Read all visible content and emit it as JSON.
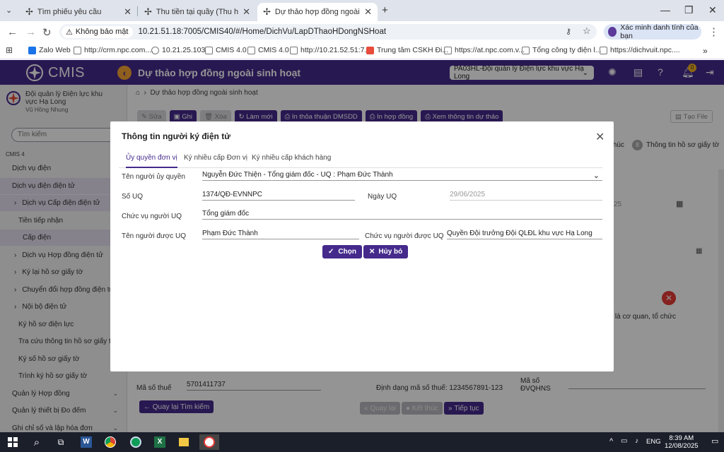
{
  "browser": {
    "tabs": [
      {
        "title": "Tìm phiếu yêu cầu",
        "active": false
      },
      {
        "title": "Thu tiền tại quầy (Thu hộ, ứng t",
        "active": false
      },
      {
        "title": "Dự thảo hợp đồng ngoài sinh h",
        "active": true
      }
    ],
    "new_tab": "+",
    "insecure_label": "Không bảo mật",
    "url": "10.21.51.18:7005/CMIS40/#/Home/DichVu/LapDThaoHDongNSHoat",
    "incognito_label": "Xác minh danh tính của bạn",
    "bookmarks": [
      "Zalo Web",
      "http://crm.npc.com....",
      "10.21.25.103",
      "CMIS 4.0",
      "CMIS 4.0",
      "http://10.21.52.51:7...",
      "Trung tâm CSKH Đi...",
      "https://at.npc.com.v...",
      "Tổng công ty điện l...",
      "https://dichvuit.npc...."
    ]
  },
  "app": {
    "logo": "CMIS",
    "page_title": "Dự thảo hợp đồng ngoài sinh hoạt",
    "unit_select": "PA03HL-Đội quản lý Điện lực khu vực Hạ Long",
    "notification_count": "0"
  },
  "sidebar": {
    "org_name": "Đội quản lý Điện lực khu vực Hạ Long",
    "user": "Vũ Hồng Nhung",
    "search_placeholder": "Tìm kiếm",
    "section": "CMIS 4",
    "items": [
      {
        "label": "Dịch vụ điện",
        "indent": 0,
        "chev": false,
        "hl": false
      },
      {
        "label": "Dịch vụ điện điện tử",
        "indent": 0,
        "chev": false,
        "hl": true
      },
      {
        "label": "Dịch vụ Cấp điện điện tử",
        "indent": 1,
        "chev": true,
        "hl": true
      },
      {
        "label": "Tiền tiếp nhận",
        "indent": 2,
        "chev": false,
        "hl": false
      },
      {
        "label": "Cấp điện",
        "indent": 2,
        "chev": false,
        "hl": true
      },
      {
        "label": "Dịch vụ Hợp đồng điện tử",
        "indent": 1,
        "chev": true,
        "hl": false
      },
      {
        "label": "Ký lại hồ sơ giấy tờ",
        "indent": 1,
        "chev": true,
        "hl": false
      },
      {
        "label": "Chuyển đổi hợp đồng điện tử",
        "indent": 1,
        "chev": true,
        "hl": false
      },
      {
        "label": "Nội bộ điện tử",
        "indent": 1,
        "chev": true,
        "hl": false
      },
      {
        "label": "Ký hồ sơ điện lực",
        "indent": 2,
        "chev": false,
        "hl": false
      },
      {
        "label": "Tra cứu thông tin hồ sơ giấy tờ",
        "indent": 2,
        "chev": false,
        "hl": false
      },
      {
        "label": "Ký số hồ sơ giấy tờ",
        "indent": 2,
        "chev": false,
        "hl": false
      },
      {
        "label": "Trình ký hồ sơ giấy tờ",
        "indent": 2,
        "chev": false,
        "hl": false
      },
      {
        "label": "Quản lý Hợp đồng",
        "indent": 0,
        "chev": true,
        "hl": false
      },
      {
        "label": "Quản lý thiết bị Đo đếm",
        "indent": 0,
        "chev": true,
        "hl": false
      },
      {
        "label": "Ghi chỉ số và lập hóa đơn",
        "indent": 0,
        "chev": true,
        "hl": false
      }
    ]
  },
  "content": {
    "breadcrumb": "Dự thảo hợp đồng ngoài sinh hoạt",
    "toolbar": [
      "Sửa",
      "Ghi",
      "Xóa",
      "Làm mới",
      "In thỏa thuận DMSDD",
      "In hợp đồng",
      "Xem thông tin dự thảo"
    ],
    "tao_file": "Tạo File",
    "step_partial": "thúc",
    "step_num": "8",
    "step_label": "Thông tin hồ sơ giấy tờ",
    "date_partial": "25",
    "org_type_partial": "ng là cơ quan, tổ chức",
    "tax_label": "Mã số thuế",
    "tax_value": "5701411737",
    "tax_format": "Định dạng mã số thuế: 1234567891-123",
    "dvqhns_label": "Mã số ĐVQHNS",
    "back_search": "Quay lại Tìm kiếm",
    "prev_btn": "Quay lại",
    "finish_btn": "Kết thúc",
    "next_btn": "Tiếp tục"
  },
  "modal": {
    "title": "Thông tin người ký điện tử",
    "tabs": [
      "Ủy quyền đơn vị",
      "Ký nhiều cấp Đơn vị",
      "Ký nhiều cấp khách hàng"
    ],
    "fields": {
      "authorizer_label": "Tên người ủy quyền",
      "authorizer_value": "Nguyễn Đức Thiện - Tổng giám đốc - UQ : Phạm Đức Thành",
      "auth_no_label": "Số UQ",
      "auth_no_value": "1374/QĐ-EVNNPC",
      "auth_date_label": "Ngày UQ",
      "auth_date_value": "29/06/2025",
      "auth_position_label": "Chức vụ người UQ",
      "auth_position_value": "Tổng giám đốc",
      "grantee_label": "Tên người được UQ",
      "grantee_value": "Phạm Đức Thành",
      "grantee_position_label": "Chức vụ người được UQ",
      "grantee_position_value": "Quyền Đội trưởng Đội QLĐL khu vực Hạ Long"
    },
    "choose_btn": "Chọn",
    "cancel_btn": "Hủy bỏ"
  },
  "taskbar": {
    "time": "8:39 AM",
    "date": "12/08/2025",
    "lang": "ENG"
  },
  "colors": {
    "brand": "#452a8c",
    "accent": "#f6a434"
  }
}
